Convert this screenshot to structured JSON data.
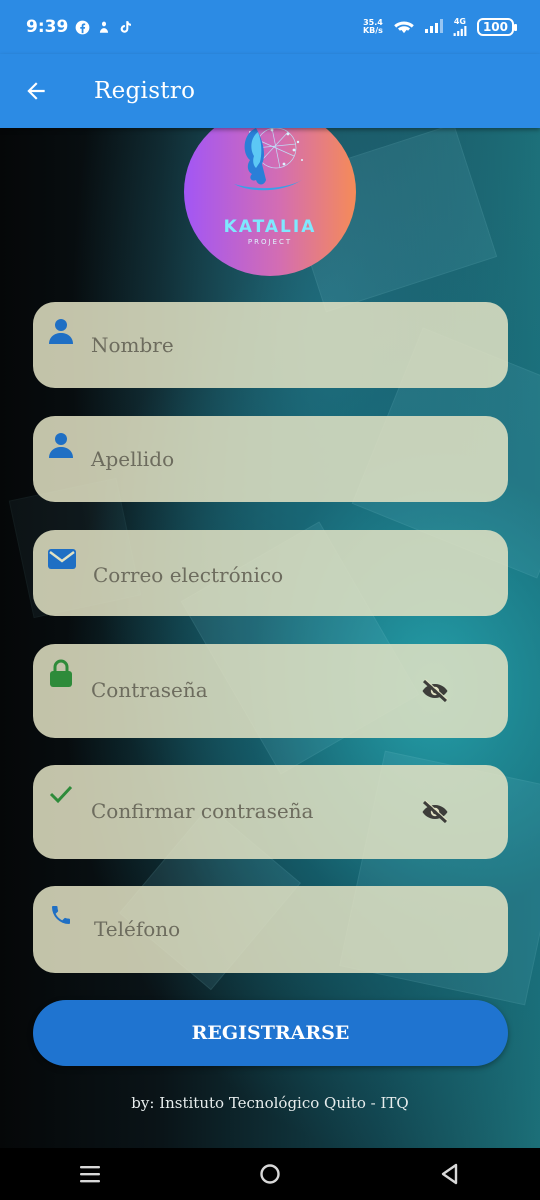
{
  "status_bar": {
    "time": "9:39",
    "net_speed_value": "35.4",
    "net_speed_unit": "KB/s",
    "network_type": "4G",
    "battery": "100",
    "icons": [
      "facebook-icon",
      "notification-icon",
      "tiktok-icon",
      "wifi-icon",
      "signal-icon",
      "battery-icon"
    ]
  },
  "app_bar": {
    "title": "Registro",
    "back_icon": "arrow-left-icon"
  },
  "logo": {
    "name": "KATALIA",
    "subtitle": "PROJECT"
  },
  "form": {
    "fields": [
      {
        "placeholder": "Nombre",
        "icon": "person-icon"
      },
      {
        "placeholder": "Apellido",
        "icon": "person-icon"
      },
      {
        "placeholder": "Correo electrónico",
        "icon": "email-icon"
      },
      {
        "placeholder": "Contraseña",
        "icon": "lock-icon",
        "toggle_icon": "eye-off-icon"
      },
      {
        "placeholder": "Confirmar contraseña",
        "icon": "check-icon",
        "toggle_icon": "eye-off-icon"
      },
      {
        "placeholder": "Teléfono",
        "icon": "phone-icon"
      }
    ],
    "submit_label": "REGISTRARSE"
  },
  "footer": {
    "credit": "by: Instituto Tecnológico Quito - ITQ"
  },
  "colors": {
    "primary": "#2c8be4",
    "button": "#1f74d0",
    "field_bg": "#e2e2c4",
    "icon_blue": "#1f6fc4",
    "icon_green": "#2e8b3a"
  }
}
